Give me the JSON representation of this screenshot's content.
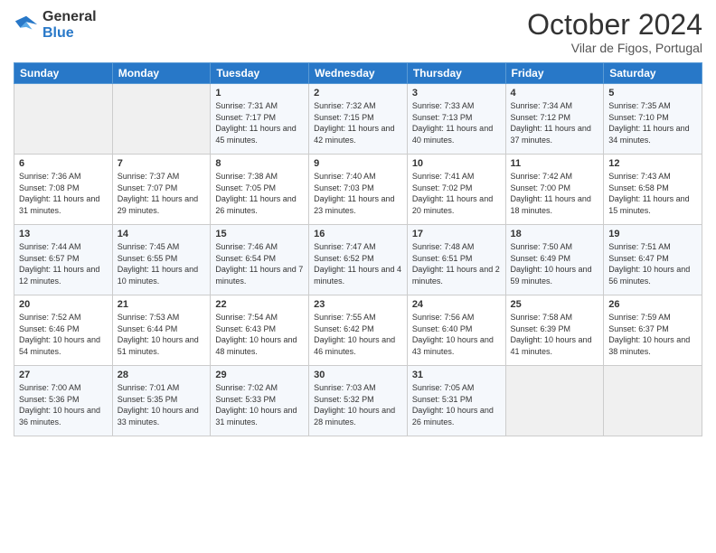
{
  "logo": {
    "line1": "General",
    "line2": "Blue"
  },
  "title": "October 2024",
  "location": "Vilar de Figos, Portugal",
  "days_header": [
    "Sunday",
    "Monday",
    "Tuesday",
    "Wednesday",
    "Thursday",
    "Friday",
    "Saturday"
  ],
  "weeks": [
    [
      {
        "day": "",
        "sunrise": "",
        "sunset": "",
        "daylight": ""
      },
      {
        "day": "",
        "sunrise": "",
        "sunset": "",
        "daylight": ""
      },
      {
        "day": "1",
        "sunrise": "Sunrise: 7:31 AM",
        "sunset": "Sunset: 7:17 PM",
        "daylight": "Daylight: 11 hours and 45 minutes."
      },
      {
        "day": "2",
        "sunrise": "Sunrise: 7:32 AM",
        "sunset": "Sunset: 7:15 PM",
        "daylight": "Daylight: 11 hours and 42 minutes."
      },
      {
        "day": "3",
        "sunrise": "Sunrise: 7:33 AM",
        "sunset": "Sunset: 7:13 PM",
        "daylight": "Daylight: 11 hours and 40 minutes."
      },
      {
        "day": "4",
        "sunrise": "Sunrise: 7:34 AM",
        "sunset": "Sunset: 7:12 PM",
        "daylight": "Daylight: 11 hours and 37 minutes."
      },
      {
        "day": "5",
        "sunrise": "Sunrise: 7:35 AM",
        "sunset": "Sunset: 7:10 PM",
        "daylight": "Daylight: 11 hours and 34 minutes."
      }
    ],
    [
      {
        "day": "6",
        "sunrise": "Sunrise: 7:36 AM",
        "sunset": "Sunset: 7:08 PM",
        "daylight": "Daylight: 11 hours and 31 minutes."
      },
      {
        "day": "7",
        "sunrise": "Sunrise: 7:37 AM",
        "sunset": "Sunset: 7:07 PM",
        "daylight": "Daylight: 11 hours and 29 minutes."
      },
      {
        "day": "8",
        "sunrise": "Sunrise: 7:38 AM",
        "sunset": "Sunset: 7:05 PM",
        "daylight": "Daylight: 11 hours and 26 minutes."
      },
      {
        "day": "9",
        "sunrise": "Sunrise: 7:40 AM",
        "sunset": "Sunset: 7:03 PM",
        "daylight": "Daylight: 11 hours and 23 minutes."
      },
      {
        "day": "10",
        "sunrise": "Sunrise: 7:41 AM",
        "sunset": "Sunset: 7:02 PM",
        "daylight": "Daylight: 11 hours and 20 minutes."
      },
      {
        "day": "11",
        "sunrise": "Sunrise: 7:42 AM",
        "sunset": "Sunset: 7:00 PM",
        "daylight": "Daylight: 11 hours and 18 minutes."
      },
      {
        "day": "12",
        "sunrise": "Sunrise: 7:43 AM",
        "sunset": "Sunset: 6:58 PM",
        "daylight": "Daylight: 11 hours and 15 minutes."
      }
    ],
    [
      {
        "day": "13",
        "sunrise": "Sunrise: 7:44 AM",
        "sunset": "Sunset: 6:57 PM",
        "daylight": "Daylight: 11 hours and 12 minutes."
      },
      {
        "day": "14",
        "sunrise": "Sunrise: 7:45 AM",
        "sunset": "Sunset: 6:55 PM",
        "daylight": "Daylight: 11 hours and 10 minutes."
      },
      {
        "day": "15",
        "sunrise": "Sunrise: 7:46 AM",
        "sunset": "Sunset: 6:54 PM",
        "daylight": "Daylight: 11 hours and 7 minutes."
      },
      {
        "day": "16",
        "sunrise": "Sunrise: 7:47 AM",
        "sunset": "Sunset: 6:52 PM",
        "daylight": "Daylight: 11 hours and 4 minutes."
      },
      {
        "day": "17",
        "sunrise": "Sunrise: 7:48 AM",
        "sunset": "Sunset: 6:51 PM",
        "daylight": "Daylight: 11 hours and 2 minutes."
      },
      {
        "day": "18",
        "sunrise": "Sunrise: 7:50 AM",
        "sunset": "Sunset: 6:49 PM",
        "daylight": "Daylight: 10 hours and 59 minutes."
      },
      {
        "day": "19",
        "sunrise": "Sunrise: 7:51 AM",
        "sunset": "Sunset: 6:47 PM",
        "daylight": "Daylight: 10 hours and 56 minutes."
      }
    ],
    [
      {
        "day": "20",
        "sunrise": "Sunrise: 7:52 AM",
        "sunset": "Sunset: 6:46 PM",
        "daylight": "Daylight: 10 hours and 54 minutes."
      },
      {
        "day": "21",
        "sunrise": "Sunrise: 7:53 AM",
        "sunset": "Sunset: 6:44 PM",
        "daylight": "Daylight: 10 hours and 51 minutes."
      },
      {
        "day": "22",
        "sunrise": "Sunrise: 7:54 AM",
        "sunset": "Sunset: 6:43 PM",
        "daylight": "Daylight: 10 hours and 48 minutes."
      },
      {
        "day": "23",
        "sunrise": "Sunrise: 7:55 AM",
        "sunset": "Sunset: 6:42 PM",
        "daylight": "Daylight: 10 hours and 46 minutes."
      },
      {
        "day": "24",
        "sunrise": "Sunrise: 7:56 AM",
        "sunset": "Sunset: 6:40 PM",
        "daylight": "Daylight: 10 hours and 43 minutes."
      },
      {
        "day": "25",
        "sunrise": "Sunrise: 7:58 AM",
        "sunset": "Sunset: 6:39 PM",
        "daylight": "Daylight: 10 hours and 41 minutes."
      },
      {
        "day": "26",
        "sunrise": "Sunrise: 7:59 AM",
        "sunset": "Sunset: 6:37 PM",
        "daylight": "Daylight: 10 hours and 38 minutes."
      }
    ],
    [
      {
        "day": "27",
        "sunrise": "Sunrise: 7:00 AM",
        "sunset": "Sunset: 5:36 PM",
        "daylight": "Daylight: 10 hours and 36 minutes."
      },
      {
        "day": "28",
        "sunrise": "Sunrise: 7:01 AM",
        "sunset": "Sunset: 5:35 PM",
        "daylight": "Daylight: 10 hours and 33 minutes."
      },
      {
        "day": "29",
        "sunrise": "Sunrise: 7:02 AM",
        "sunset": "Sunset: 5:33 PM",
        "daylight": "Daylight: 10 hours and 31 minutes."
      },
      {
        "day": "30",
        "sunrise": "Sunrise: 7:03 AM",
        "sunset": "Sunset: 5:32 PM",
        "daylight": "Daylight: 10 hours and 28 minutes."
      },
      {
        "day": "31",
        "sunrise": "Sunrise: 7:05 AM",
        "sunset": "Sunset: 5:31 PM",
        "daylight": "Daylight: 10 hours and 26 minutes."
      },
      {
        "day": "",
        "sunrise": "",
        "sunset": "",
        "daylight": ""
      },
      {
        "day": "",
        "sunrise": "",
        "sunset": "",
        "daylight": ""
      }
    ]
  ]
}
